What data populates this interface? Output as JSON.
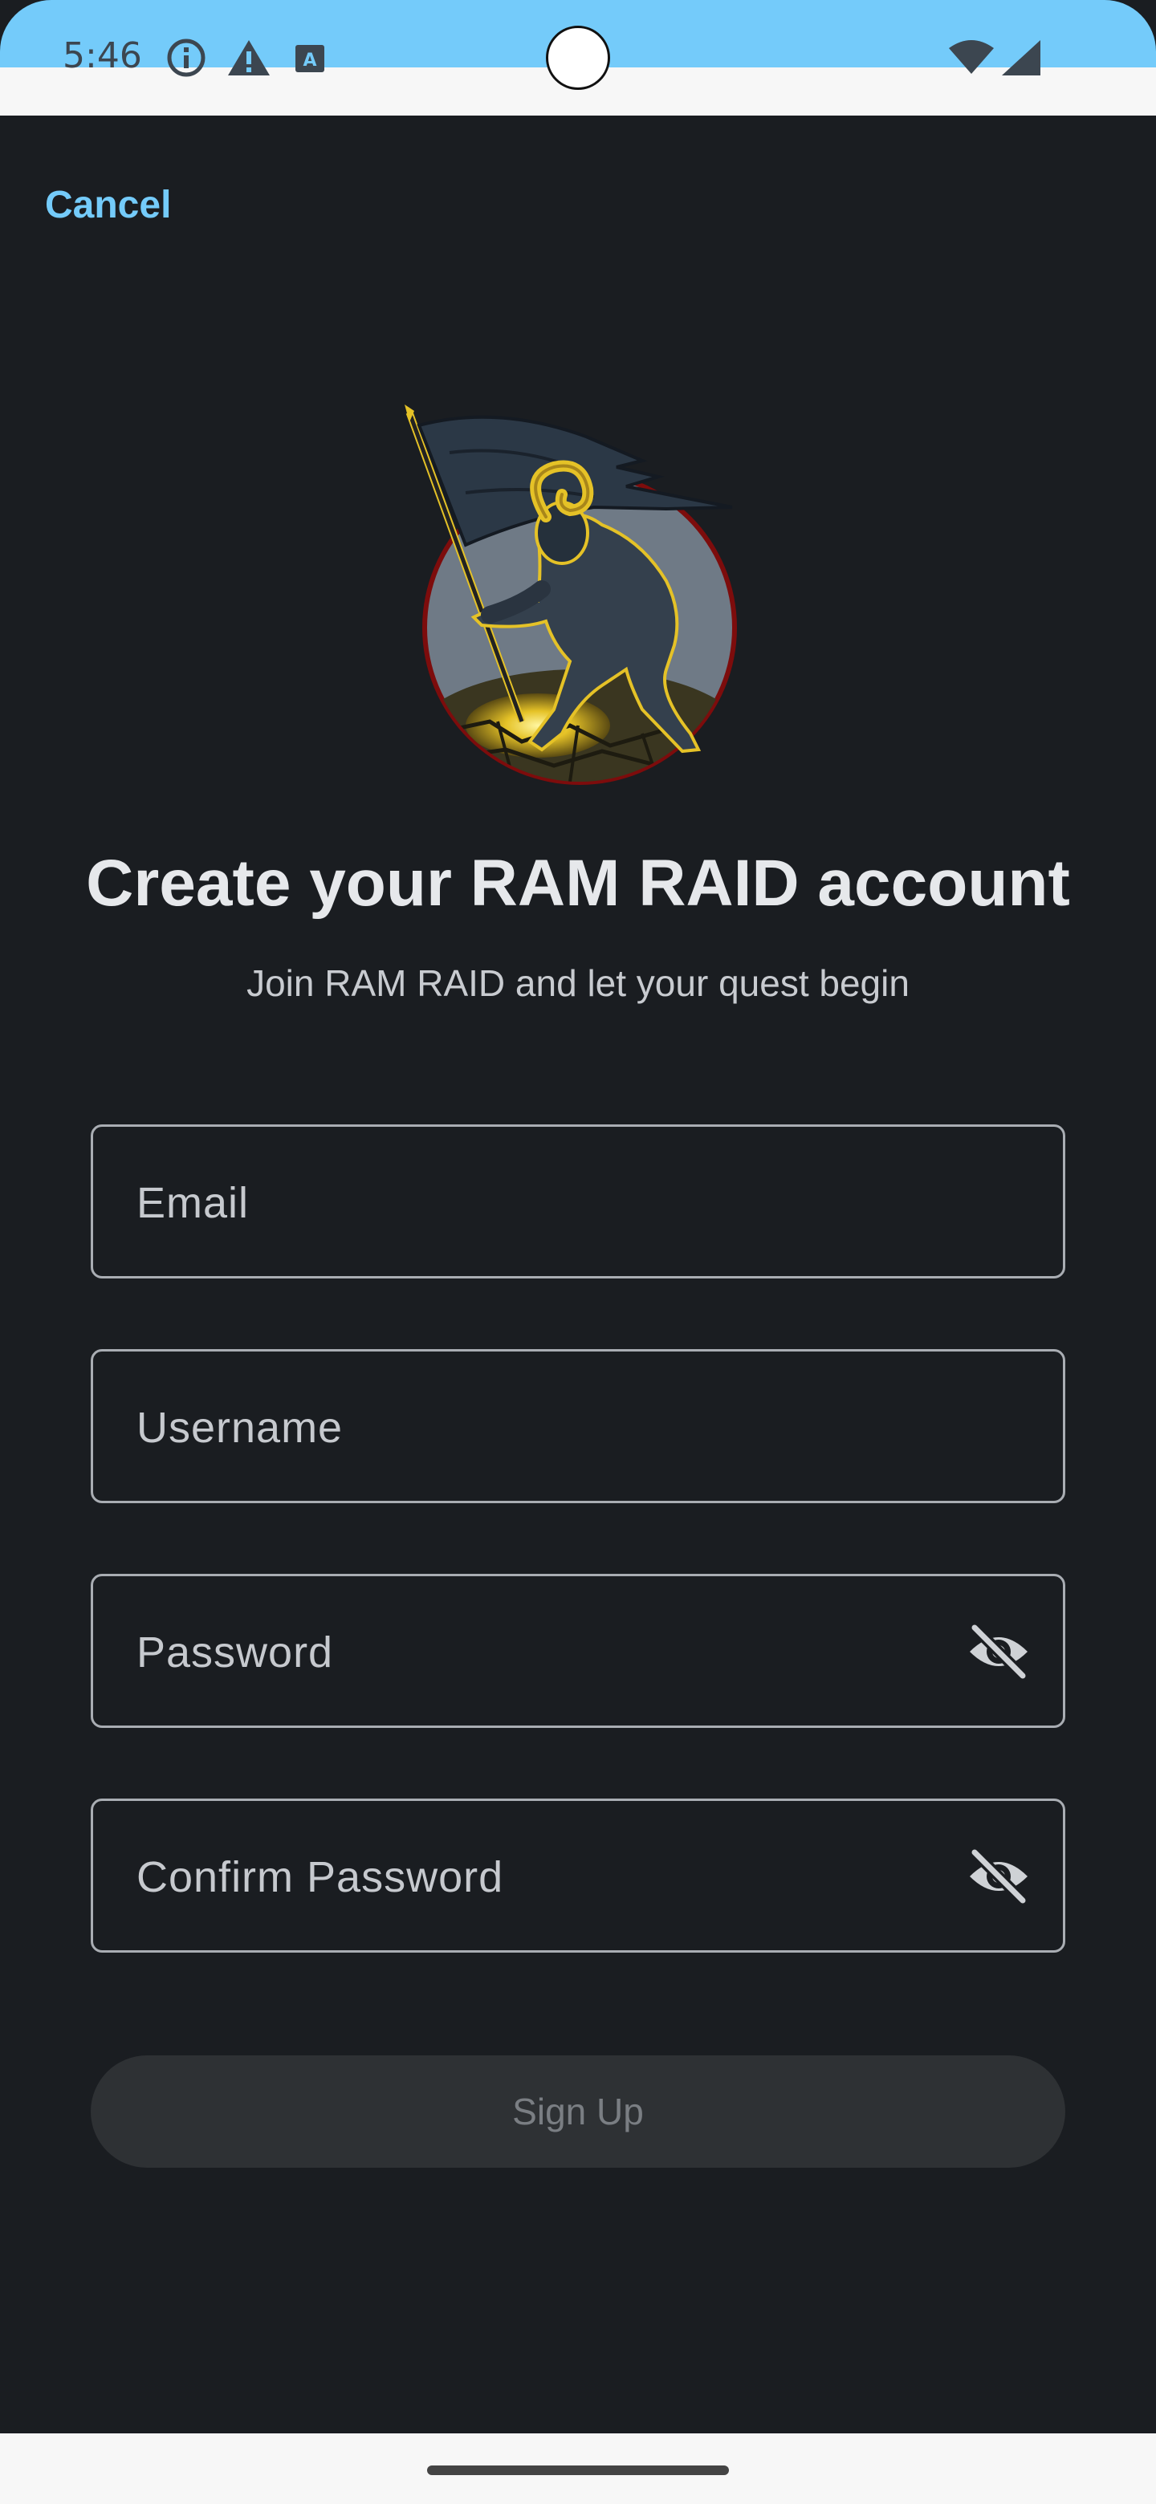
{
  "status_bar": {
    "time": "5:46",
    "icons": [
      "info-icon",
      "warning-icon",
      "translate-icon",
      "wifi-icon",
      "signal-icon"
    ],
    "colors": {
      "background": "#74cbfa",
      "strip": "#f7f7f7"
    }
  },
  "header": {
    "cancel_label": "Cancel"
  },
  "logo": {
    "icon": "ram-warrior-flag-logo"
  },
  "content": {
    "title": "Create your RAM RAID account",
    "subtitle": "Join RAM RAID and let your quest begin"
  },
  "form": {
    "email": {
      "placeholder": "Email",
      "value": ""
    },
    "username": {
      "placeholder": "Username",
      "value": ""
    },
    "password": {
      "placeholder": "Password",
      "value": "",
      "toggle_icon": "eye-off-icon"
    },
    "confirm_password": {
      "placeholder": "Confirm Password",
      "value": "",
      "toggle_icon": "eye-off-icon"
    },
    "submit_label": "Sign Up"
  },
  "theme": {
    "background": "#1a1d21",
    "accent": "#74cbfa",
    "text_primary": "#e6e8eb",
    "border": "#a9adb3",
    "button_disabled": "#2e3134"
  }
}
